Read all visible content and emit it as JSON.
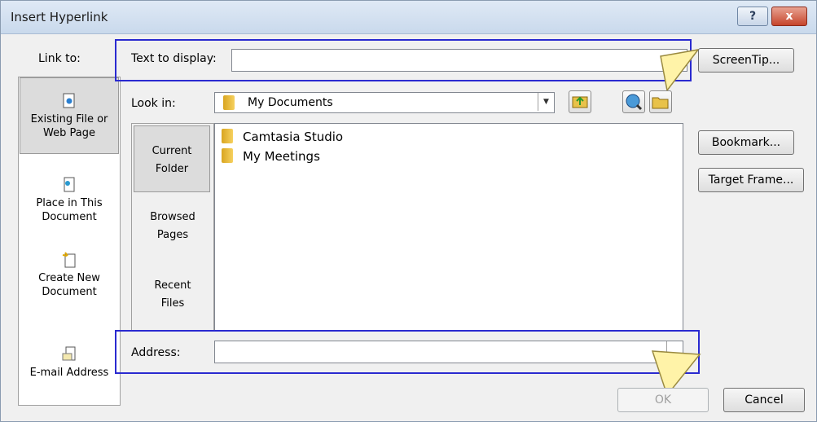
{
  "window": {
    "title": "Insert Hyperlink",
    "help_label": "?",
    "close_label": "x"
  },
  "link_to": {
    "label": "Link to:",
    "items": [
      {
        "label_line1": "Existing File or",
        "label_line2": "Web Page",
        "icon": "existing-file-icon",
        "selected": true
      },
      {
        "label_line1": "Place in This",
        "label_line2": "Document",
        "icon": "place-in-document-icon",
        "selected": false
      },
      {
        "label_line1": "Create New",
        "label_line2": "Document",
        "icon": "new-document-icon",
        "selected": false
      },
      {
        "label_line1": "E-mail Address",
        "label_line2": "",
        "icon": "email-address-icon",
        "selected": false
      }
    ]
  },
  "text_to_display": {
    "label": "Text to display:",
    "value": ""
  },
  "screentip_button": "ScreenTip...",
  "look_in": {
    "label": "Look in:",
    "value": "My Documents"
  },
  "browse_tabs": [
    {
      "line1": "Current",
      "line2": "Folder",
      "selected": true
    },
    {
      "line1": "Browsed",
      "line2": "Pages",
      "selected": false
    },
    {
      "line1": "Recent",
      "line2": "Files",
      "selected": false
    }
  ],
  "files": [
    "Camtasia Studio",
    "My Meetings"
  ],
  "side_buttons": {
    "bookmark": "Bookmark...",
    "target_frame": "Target Frame..."
  },
  "address": {
    "label": "Address:",
    "value": ""
  },
  "ok_button": "OK",
  "cancel_button": "Cancel",
  "colors": {
    "highlight_border": "#2a2ad0",
    "callout_arrow": "#fff3a8"
  }
}
